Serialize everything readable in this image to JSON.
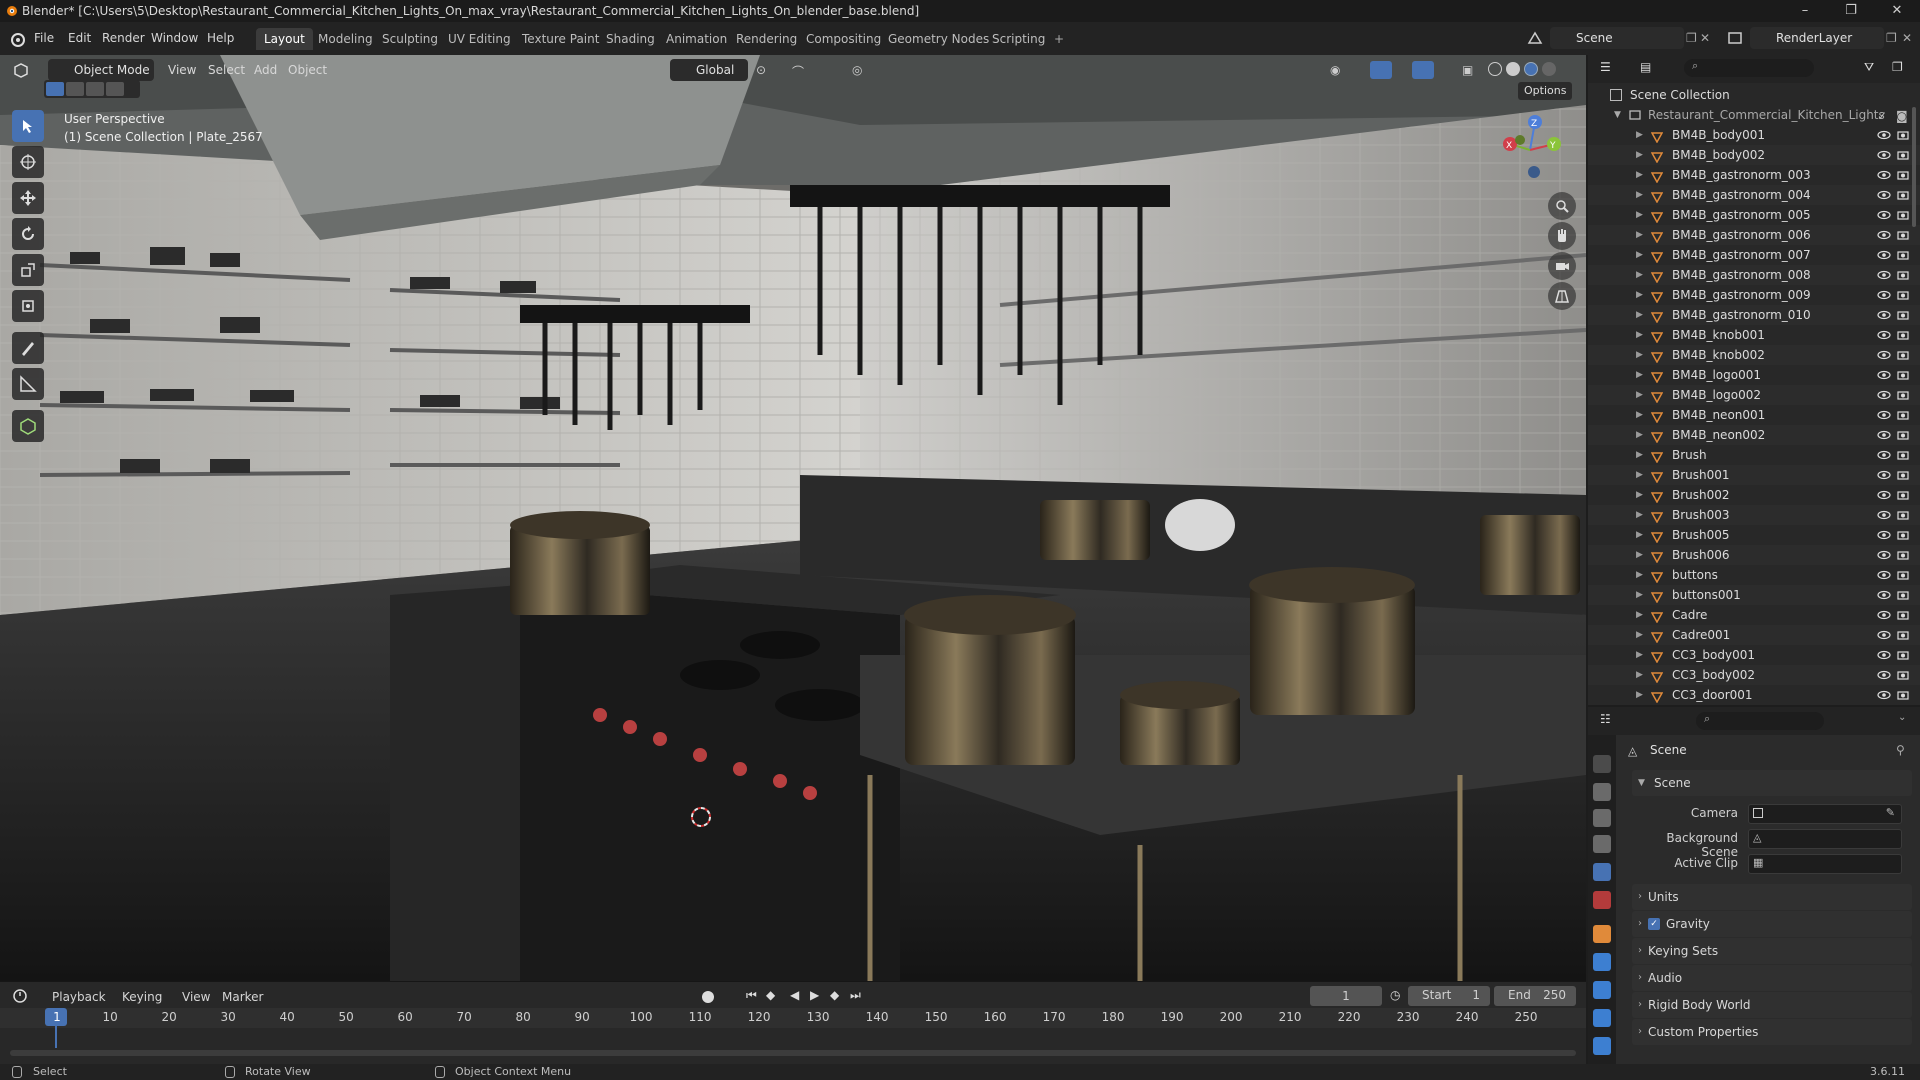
{
  "window": {
    "title": "Blender* [C:\\Users\\5\\Desktop\\Restaurant_Commercial_Kitchen_Lights_On_max_vray\\Restaurant_Commercial_Kitchen_Lights_On_blender_base.blend]",
    "controls": [
      "–",
      "❐",
      "✕"
    ]
  },
  "menus": [
    "File",
    "Edit",
    "Render",
    "Window",
    "Help"
  ],
  "workspaces": [
    "Layout",
    "Modeling",
    "Sculpting",
    "UV Editing",
    "Texture Paint",
    "Shading",
    "Animation",
    "Rendering",
    "Compositing",
    "Geometry Nodes",
    "Scripting"
  ],
  "active_workspace": "Layout",
  "add_workspace": "+",
  "scene_field": "Scene",
  "view_layer_field": "RenderLayer",
  "viewport_header": {
    "mode": "Object Mode",
    "menus": [
      "View",
      "Select",
      "Add",
      "Object"
    ],
    "transform_orientation": "Global",
    "options": "Options"
  },
  "viewport_overlay": {
    "line1": "User Perspective",
    "line2": "(1) Scene Collection | Plate_2567"
  },
  "gizmo_axes": {
    "z": "Z",
    "y": "Y",
    "x": "X"
  },
  "timeline": {
    "menus": [
      "Playback",
      "Keying",
      "View",
      "Marker"
    ],
    "current_frame": "1",
    "start_label": "Start",
    "start": "1",
    "end_label": "End",
    "end": "250",
    "ticks": [
      "1",
      "10",
      "20",
      "30",
      "40",
      "50",
      "60",
      "70",
      "80",
      "90",
      "100",
      "110",
      "120",
      "130",
      "140",
      "150",
      "160",
      "170",
      "180",
      "190",
      "200",
      "210",
      "220",
      "230",
      "240",
      "250"
    ]
  },
  "statusbar": {
    "select": "Select",
    "rotate": "Rotate View",
    "context": "Object Context Menu",
    "version": "3.6.11"
  },
  "outliner": {
    "root": "Scene Collection",
    "collection": "Restaurant_Commercial_Kitchen_Lights",
    "items": [
      "BM4B_body001",
      "BM4B_body002",
      "BM4B_gastronorm_003",
      "BM4B_gastronorm_004",
      "BM4B_gastronorm_005",
      "BM4B_gastronorm_006",
      "BM4B_gastronorm_007",
      "BM4B_gastronorm_008",
      "BM4B_gastronorm_009",
      "BM4B_gastronorm_010",
      "BM4B_knob001",
      "BM4B_knob002",
      "BM4B_logo001",
      "BM4B_logo002",
      "BM4B_neon001",
      "BM4B_neon002",
      "Brush",
      "Brush001",
      "Brush002",
      "Brush003",
      "Brush005",
      "Brush006",
      "buttons",
      "buttons001",
      "Cadre",
      "Cadre001",
      "CC3_body001",
      "CC3_body002",
      "CC3_door001"
    ]
  },
  "properties": {
    "context": "Scene",
    "panel": "Scene",
    "camera_label": "Camera",
    "background_label": "Background Scene",
    "clip_label": "Active Clip",
    "sections": [
      "Units",
      "Gravity",
      "Keying Sets",
      "Audio",
      "Rigid Body World",
      "Custom Properties"
    ]
  },
  "colors": {
    "accent": "#4772b3",
    "frame_marker": "#4772b3",
    "object_icon": "#e08a3a",
    "header_bg": "#232323"
  }
}
